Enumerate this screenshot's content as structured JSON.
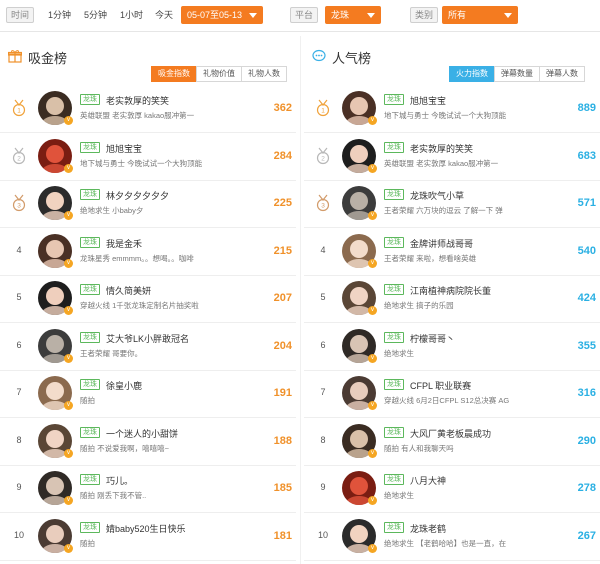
{
  "filters": {
    "time_label": "时间",
    "time_options": [
      "1分钟",
      "5分钟",
      "1小时",
      "今天"
    ],
    "date_range": "05-07至05-13",
    "platform_label": "平台",
    "platform_value": "龙珠",
    "category_label": "类别",
    "category_value": "所有"
  },
  "colors": {
    "accent_orange": "#f47b20",
    "accent_blue": "#3ab0e6",
    "tag_green": "#5cb85c"
  },
  "left_panel": {
    "title": "吸金榜",
    "icon": "gift-icon",
    "tabs": [
      "吸金指数",
      "礼物价值",
      "礼物人数"
    ],
    "rows": [
      {
        "rank": "1",
        "tag": "龙珠",
        "name": "老实敦厚的笑笑",
        "sub": "英雄联盟 老实敦厚 kakao服冲第一",
        "score": "362"
      },
      {
        "rank": "2",
        "tag": "龙珠",
        "name": "旭旭宝宝",
        "sub": "地下城与勇士 今晚试试一个大狗顶能",
        "score": "284"
      },
      {
        "rank": "3",
        "tag": "龙珠",
        "name": "林夕夕夕夕夕夕",
        "sub": "绝地求生 小baby夕",
        "score": "225"
      },
      {
        "rank": "4",
        "tag": "龙珠",
        "name": "我是金禾",
        "sub": "龙珠星秀 emmmm。。想喝。。咖啡",
        "score": "215"
      },
      {
        "rank": "5",
        "tag": "龙珠",
        "name": "情久简美妍",
        "sub": "穿越火线 1千张龙珠定制名片抽奖啦",
        "score": "207"
      },
      {
        "rank": "6",
        "tag": "龙珠",
        "name": "艾大爷LK小胖敢冠名",
        "sub": "王者荣耀 哥要你。",
        "score": "204"
      },
      {
        "rank": "7",
        "tag": "龙珠",
        "name": "徐皇小鹿",
        "sub": "随拍",
        "score": "191"
      },
      {
        "rank": "8",
        "tag": "龙珠",
        "name": "一个迷人的小甜饼",
        "sub": "随拍 不说爱我啊，嘻嘻嘻~",
        "score": "188"
      },
      {
        "rank": "9",
        "tag": "龙珠",
        "name": "巧儿。",
        "sub": "随拍 刚丢下我不管..",
        "score": "185"
      },
      {
        "rank": "10",
        "tag": "龙珠",
        "name": "婧baby520生日快乐",
        "sub": "随拍",
        "score": "181"
      }
    ]
  },
  "right_panel": {
    "title": "人气榜",
    "icon": "chat-icon",
    "tabs": [
      "火力指数",
      "弹幕数量",
      "弹幕人数"
    ],
    "rows": [
      {
        "rank": "1",
        "tag": "龙珠",
        "name": "旭旭宝宝",
        "sub": "地下城与勇士 今晚试试一个大狗顶能",
        "score": "889"
      },
      {
        "rank": "2",
        "tag": "龙珠",
        "name": "老实敦厚的笑笑",
        "sub": "英雄联盟 老实敦厚 kakao服冲第一",
        "score": "683"
      },
      {
        "rank": "3",
        "tag": "龙珠",
        "name": "龙珠吹气小草",
        "sub": "王者荣耀 六万块的逗云 了解一下 弹",
        "score": "571"
      },
      {
        "rank": "4",
        "tag": "龙珠",
        "name": "金牌讲师战哥哥",
        "sub": "王者荣耀 来啦，想看啥英雄",
        "score": "540"
      },
      {
        "rank": "5",
        "tag": "龙珠",
        "name": "江南植神病院院长董",
        "sub": "绝地求生 搞子的乐园",
        "score": "424"
      },
      {
        "rank": "6",
        "tag": "龙珠",
        "name": "柠檬哥哥丶",
        "sub": "绝地求生",
        "score": "355"
      },
      {
        "rank": "7",
        "tag": "龙珠",
        "name": "CFPL 职业联赛",
        "sub": "穿越火线 6月2日CFPL S12总决赛 AG",
        "score": "316"
      },
      {
        "rank": "8",
        "tag": "龙珠",
        "name": "大风厂黄老板晨成功",
        "sub": "随拍 有人和我聊天吗",
        "score": "290"
      },
      {
        "rank": "9",
        "tag": "龙珠",
        "name": "八月大神",
        "sub": "绝地求生",
        "score": "278"
      },
      {
        "rank": "10",
        "tag": "龙珠",
        "name": "龙珠老鹤",
        "sub": "绝地求生 【老鹤哈哈】也是一直，在",
        "score": "267"
      }
    ]
  }
}
